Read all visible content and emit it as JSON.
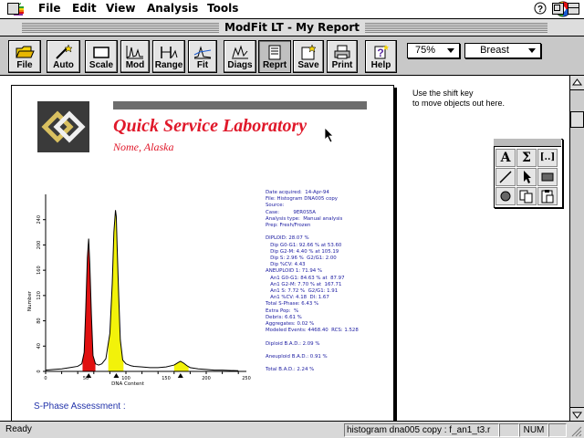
{
  "menubar": {
    "items": [
      "File",
      "Edit",
      "View",
      "Analysis",
      "Tools"
    ]
  },
  "window": {
    "title": "ModFit LT - My Report"
  },
  "toolbar": {
    "buttons": [
      "File",
      "Auto",
      "Scale",
      "Mod",
      "Range",
      "Fit",
      "Diags",
      "Reprt",
      "Save",
      "Print",
      "Help"
    ],
    "zoom": "75%",
    "tissue": "Breast"
  },
  "report": {
    "lab_name": "Quick Service Laboratory",
    "lab_location": "Nome, Alaska",
    "info_lines": [
      "Date acquired:  14-Apr-94",
      "File: Histogram DNA005 copy",
      "Source:",
      "Case:         9ER0S5A",
      "Analysis type:  Manual analysis",
      "Prep: Fresh/Frozen",
      "",
      "DIPLOID: 28.07 %",
      "   Dip G0-G1: 92.66 % at 53.60",
      "   Dip G2-M: 4.40 % at 105.19",
      "   Dip S: 2.96 %  G2/G1: 2.00",
      "   Dip %CV: 4.43",
      "ANEUPLOID 1: 71.94 %",
      "   An1 G0-G1: 84.63 % at  87.97",
      "   An1 G2-M: 7.70 % at  167.71",
      "   An1 S: 7.72 %  G2/G1: 1.91",
      "   An1 %CV: 4.18  DI: 1.67",
      "Total S-Phase: 6.43 %",
      "Extra Pop:  %",
      "Debris: 6.61 %",
      "Aggregates: 0.02 %",
      "Modeled Events: 4468.40  RCS: 1.528",
      "",
      "Diploid B.A.D.: 2.09 %",
      "",
      "Aneuploid B.A.D.: 0.91 %",
      "",
      "Total B.A.D.: 2.24 %"
    ],
    "sphase_heading": "S-Phase Assessment :"
  },
  "note": {
    "line1": "Use the shift key",
    "line2": "to move objects out here."
  },
  "palette": {
    "tools": [
      "A",
      "Σ",
      "[..]",
      "/",
      "pointer",
      "rect",
      "oval",
      "copy",
      "paste"
    ]
  },
  "status": {
    "ready": "Ready",
    "file": "histogram dna005 copy : f_an1_t3.r",
    "num": "NUM"
  },
  "chart_data": {
    "type": "area",
    "xlabel": "DNA Content",
    "ylabel": "Number",
    "xlim": [
      0,
      250
    ],
    "ylim": [
      0,
      280
    ],
    "x_ticks": [
      0,
      20,
      40,
      60,
      80,
      100,
      120,
      140,
      160,
      180,
      200,
      220,
      240
    ],
    "x_tick_labels": [
      "0",
      "50",
      "100",
      "150",
      "200",
      "250"
    ],
    "y_tick_labels": [
      "0",
      "40",
      "80",
      "120",
      "160",
      "200",
      "240"
    ],
    "series": [
      {
        "values_x": [
          0,
          10,
          20,
          30,
          40,
          45,
          48,
          50,
          52,
          53.6,
          55,
          57,
          59,
          62,
          66,
          70,
          75,
          80,
          83,
          85,
          87,
          88,
          89,
          91,
          93,
          96,
          100,
          104,
          106,
          110,
          120,
          130,
          140,
          150,
          160,
          165,
          168,
          172,
          176,
          180,
          190,
          200,
          210,
          220,
          240
        ],
        "values_y": [
          2,
          3,
          4,
          6,
          8,
          12,
          30,
          100,
          180,
          210,
          170,
          90,
          25,
          12,
          10,
          12,
          20,
          60,
          140,
          220,
          255,
          245,
          200,
          120,
          50,
          18,
          12,
          10,
          9,
          8,
          7,
          6,
          6,
          7,
          10,
          14,
          16,
          13,
          9,
          6,
          4,
          3,
          2,
          2,
          1
        ],
        "color": "#000000"
      }
    ],
    "fills": [
      {
        "name": "red",
        "color": "#e01010",
        "x_from": 46,
        "x_to": 62
      },
      {
        "name": "yellow",
        "color": "#f2f20a",
        "x_from": 78,
        "x_to": 97
      },
      {
        "name": "yellow",
        "color": "#f2f20a",
        "x_from": 160,
        "x_to": 178
      }
    ]
  }
}
